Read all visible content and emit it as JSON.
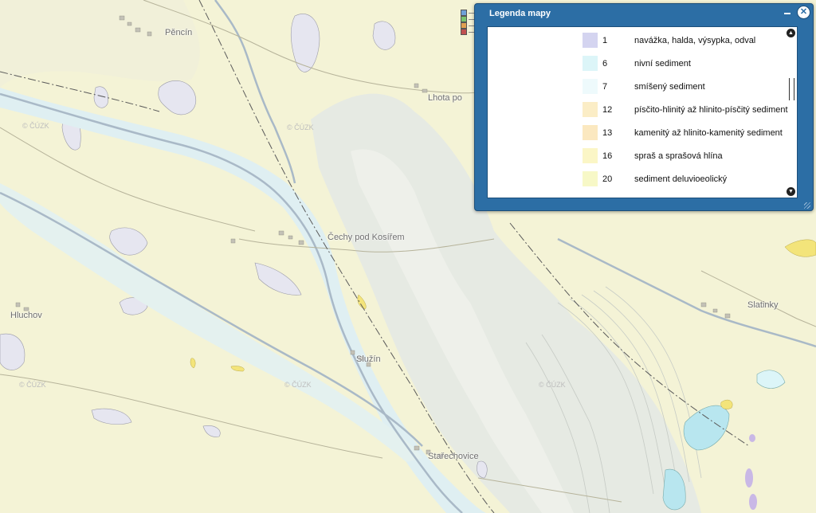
{
  "map": {
    "places": [
      {
        "id": "pencin",
        "name": "Pěncín"
      },
      {
        "id": "lhota",
        "name": "Lhota po"
      },
      {
        "id": "cechy",
        "name": "Čechy pod Kosířem"
      },
      {
        "id": "hluchov",
        "name": "Hluchov"
      },
      {
        "id": "sluzin",
        "name": "Služín"
      },
      {
        "id": "starechovice",
        "name": "Stařechovice"
      },
      {
        "id": "slatinky",
        "name": "Slatinky"
      }
    ],
    "watermark": "© ČÚZK"
  },
  "legend": {
    "title": "Legenda mapy",
    "minimize_icon": "minimize-icon",
    "close_icon": "close-icon",
    "items": [
      {
        "code": "1",
        "label": "navážka, halda, výsypka, odval",
        "color": "#d4d4f0"
      },
      {
        "code": "6",
        "label": "nivní sediment",
        "color": "#dcf5f8"
      },
      {
        "code": "7",
        "label": "smíšený sediment",
        "color": "#eefafc"
      },
      {
        "code": "12",
        "label": "písčito-hlinitý až hlinito-písčitý sediment",
        "color": "#fbedc6"
      },
      {
        "code": "13",
        "label": "kamenitý až hlinito-kamenitý sediment",
        "color": "#fbe8c0"
      },
      {
        "code": "16",
        "label": "spraš a sprašová hlína",
        "color": "#fbf6c6"
      },
      {
        "code": "20",
        "label": "sediment deluvioeolický",
        "color": "#f7f8c7"
      }
    ]
  },
  "colors": {
    "base": "#f4f3d6",
    "loess": "#f8f7d2",
    "lavender": "#e6e6f0",
    "river": "#dfeff2",
    "water": "#aab8c6",
    "green_zone": "#e7ebe3",
    "legend_blue": "#2c6ea5"
  }
}
